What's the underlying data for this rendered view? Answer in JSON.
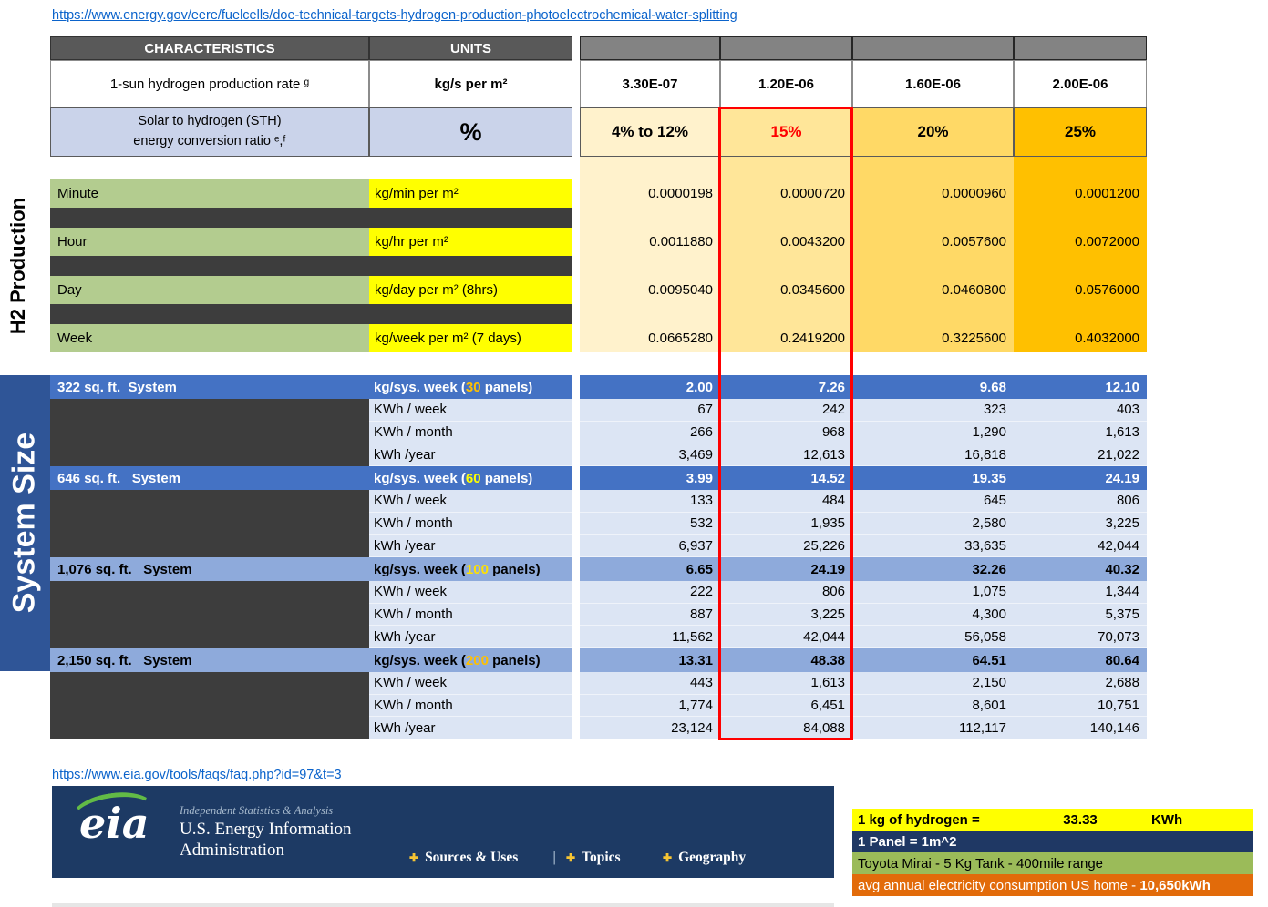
{
  "links": {
    "doe": "https://www.energy.gov/eere/fuelcells/doe-technical-targets-hydrogen-production-photoelectrochemical-water-splitting",
    "eia": "https://www.eia.gov/tools/faqs/faq.php?id=97&t=3"
  },
  "table": {
    "header": {
      "characteristics": "CHARACTERISTICS",
      "units": "UNITS"
    },
    "production_rate": {
      "label": "1-sun hydrogen production rate ᵍ",
      "unit": "kg/s per m²",
      "values": [
        "3.30E-07",
        "1.20E-06",
        "1.60E-06",
        "2.00E-06"
      ]
    },
    "sth": {
      "label_line1": "Solar to hydrogen (STH)",
      "label_line2": "energy conversion ratio ᵉ,ᶠ",
      "unit": "%",
      "values": [
        "4% to 12%",
        "15%",
        "20%",
        "25%"
      ]
    }
  },
  "h2_production": {
    "section_label": "H2 Production",
    "rows": [
      {
        "label": "Minute",
        "unit": "kg/min per m²",
        "values": [
          "0.0000198",
          "0.0000720",
          "0.0000960",
          "0.0001200"
        ]
      },
      {
        "label": "Hour",
        "unit": "kg/hr per m²",
        "values": [
          "0.0011880",
          "0.0043200",
          "0.0057600",
          "0.0072000"
        ]
      },
      {
        "label": "Day",
        "unit": "kg/day per m² (8hrs)",
        "values": [
          "0.0095040",
          "0.0345600",
          "0.0460800",
          "0.0576000"
        ]
      },
      {
        "label": "Week",
        "unit": "kg/week per m² (7 days)",
        "values": [
          "0.0665280",
          "0.2419200",
          "0.3225600",
          "0.4032000"
        ]
      }
    ]
  },
  "system_size": {
    "section_label": "System Size",
    "systems": [
      {
        "label": "322 sq. ft.  System",
        "unit_prefix": "kg/sys. week (",
        "panels": "30",
        "unit_suffix": " panels)",
        "panels_color": "#FFC000",
        "week_values": [
          "2.00",
          "7.26",
          "9.68",
          "12.10"
        ],
        "rows": [
          {
            "label": "KWh / week",
            "values": [
              "67",
              "242",
              "323",
              "403"
            ]
          },
          {
            "label": "KWh / month",
            "values": [
              "266",
              "968",
              "1,290",
              "1,613"
            ]
          },
          {
            "label": "kWh /year",
            "values": [
              "3,469",
              "12,613",
              "16,818",
              "21,022"
            ]
          }
        ]
      },
      {
        "label": "646 sq. ft.   System",
        "unit_prefix": "kg/sys. week (",
        "panels": "60",
        "unit_suffix": " panels)",
        "panels_color": "#FFFF00",
        "week_values": [
          "3.99",
          "14.52",
          "19.35",
          "24.19"
        ],
        "rows": [
          {
            "label": "KWh / week",
            "values": [
              "133",
              "484",
              "645",
              "806"
            ]
          },
          {
            "label": "KWh / month",
            "values": [
              "532",
              "1,935",
              "2,580",
              "3,225"
            ]
          },
          {
            "label": "kWh /year",
            "values": [
              "6,937",
              "25,226",
              "33,635",
              "42,044"
            ]
          }
        ]
      },
      {
        "label": "1,076 sq. ft.   System",
        "unit_prefix": "kg/sys. week (",
        "panels": "100",
        "unit_suffix": " panels)",
        "panels_color": "#FFE100",
        "week_values": [
          "6.65",
          "24.19",
          "32.26",
          "40.32"
        ],
        "rows": [
          {
            "label": "KWh / week",
            "values": [
              "222",
              "806",
              "1,075",
              "1,344"
            ]
          },
          {
            "label": "KWh / month",
            "values": [
              "887",
              "3,225",
              "4,300",
              "5,375"
            ]
          },
          {
            "label": "kWh /year",
            "values": [
              "11,562",
              "42,044",
              "56,058",
              "70,073"
            ]
          }
        ]
      },
      {
        "label": "2,150 sq. ft.   System",
        "unit_prefix": "kg/sys. week (",
        "panels": "200",
        "unit_suffix": " panels)",
        "panels_color": "#FFC000",
        "week_values": [
          "13.31",
          "48.38",
          "64.51",
          "80.64"
        ],
        "rows": [
          {
            "label": "KWh / week",
            "values": [
              "443",
              "1,613",
              "2,150",
              "2,688"
            ]
          },
          {
            "label": "KWh / month",
            "values": [
              "1,774",
              "6,451",
              "8,601",
              "10,751"
            ]
          },
          {
            "label": "kWh /year",
            "values": [
              "23,124",
              "84,088",
              "112,117",
              "140,146"
            ]
          }
        ]
      }
    ]
  },
  "banner": {
    "logo_text": "eia",
    "tagline": "Independent Statistics & Analysis",
    "title_line1": "U.S. Energy Information",
    "title_line2": "Administration",
    "plus_icon": "✚",
    "separator": "|",
    "nav": [
      {
        "label": "Sources & Uses"
      },
      {
        "label": "Topics"
      },
      {
        "label": "Geography"
      }
    ]
  },
  "info_box": {
    "row1": {
      "label": "1 kg of hydrogen =",
      "value": "33.33",
      "unit": "KWh"
    },
    "row2": {
      "text": "1 Panel = 1m^2"
    },
    "row3": {
      "text": "Toyota Mirai - 5 Kg Tank - 400mile range"
    },
    "row4": {
      "label": "avg annual electricity consumption US home - ",
      "value": "10,650kWh"
    }
  },
  "theme": {
    "cream": "#FFF2CC",
    "gold_light": "#FFE699",
    "gold": "#FFD966",
    "accent_orange": "#FFC000",
    "header_blue": "#4472C4",
    "header_blue_light": "#8EAADB",
    "row_blue_light": "#DCE5F4",
    "sidebar_blue": "#2F5597",
    "label_green": "#B3CC8F",
    "unit_yellow": "#FFFF00",
    "highlight_red": "#FF0000",
    "charcoal": "#3D3D3D",
    "eia_navy": "#1D3A64",
    "eia_green": "#62BB46",
    "eia_gold": "#F5C433",
    "info_navy": "#1F3864",
    "info_green": "#9BBB59",
    "info_orange": "#E26B0A",
    "link_blue": "#0B63CB"
  }
}
